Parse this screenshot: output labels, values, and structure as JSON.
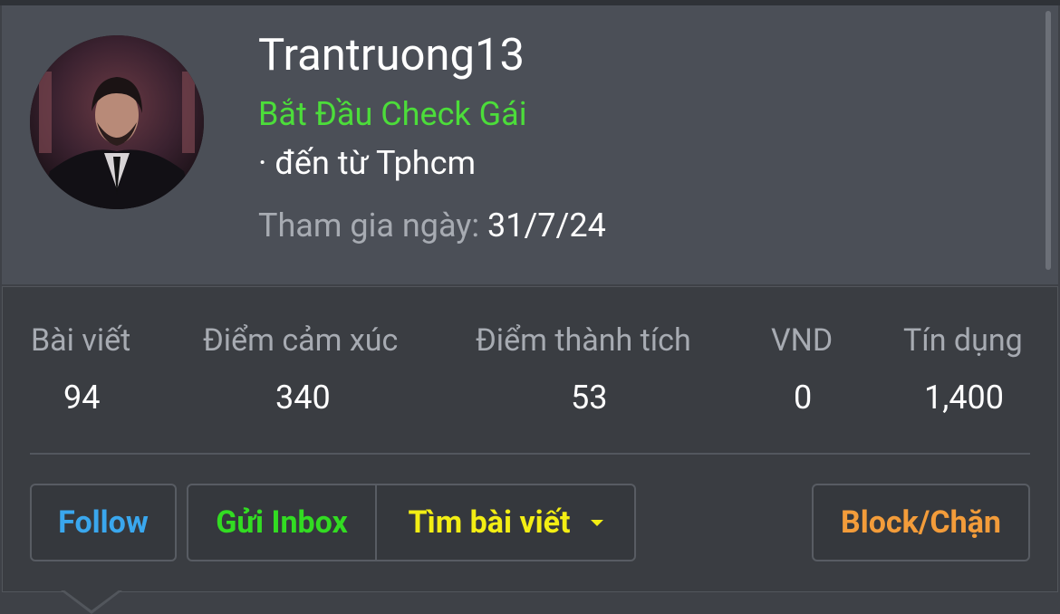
{
  "profile": {
    "username": "Trantruong13",
    "title": "Bắt Đầu Check Gái",
    "location": "· đến từ Tphcm",
    "joined_label": "Tham gia ngày:",
    "joined_value": "31/7/24"
  },
  "stats": [
    {
      "label": "Bài viết",
      "value": "94"
    },
    {
      "label": "Điểm cảm xúc",
      "value": "340"
    },
    {
      "label": "Điểm thành tích",
      "value": "53"
    },
    {
      "label": "VND",
      "value": "0"
    },
    {
      "label": "Tín dụng",
      "value": "1,400"
    }
  ],
  "actions": {
    "follow": "Follow",
    "inbox": "Gửi Inbox",
    "find_posts": "Tìm bài viết",
    "block": "Block/Chặn"
  },
  "colors": {
    "title": "#4cdd3a",
    "follow": "#3aa7ee",
    "inbox": "#32dc22",
    "find_posts": "#f3ee14",
    "block": "#f39c3a"
  }
}
